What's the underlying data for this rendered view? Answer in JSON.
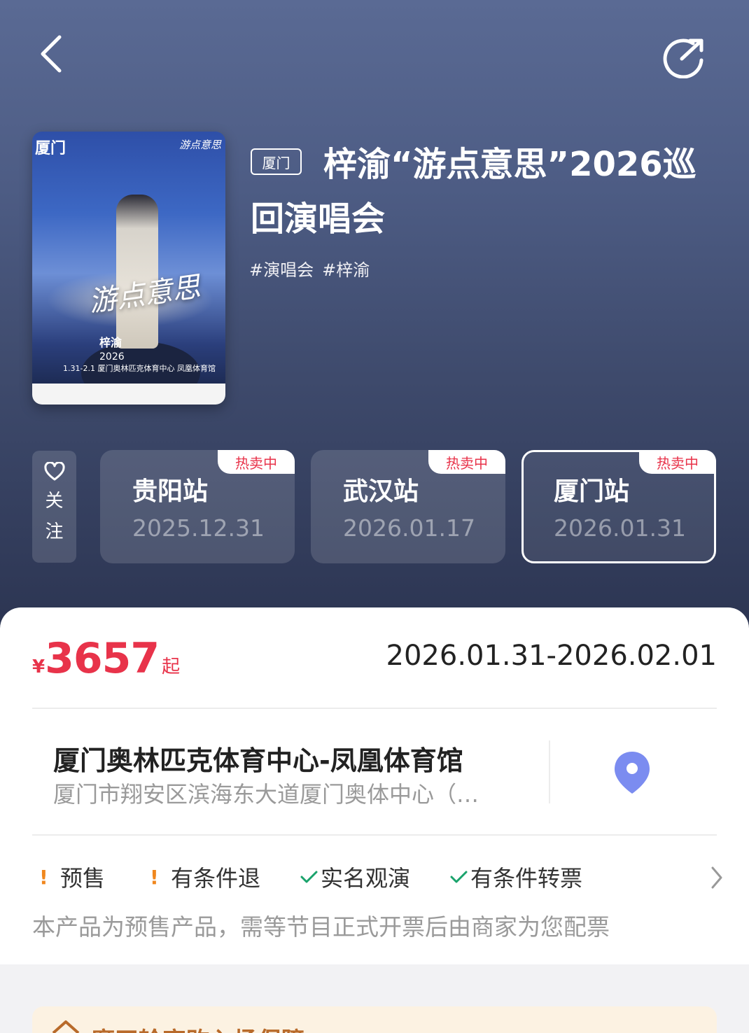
{
  "header": {
    "back_icon": "chevron-left-icon",
    "share_icon": "share-icon"
  },
  "poster": {
    "city": "厦门",
    "logo_text": "游点意思",
    "art_title": "游点意思",
    "artist": "梓渝",
    "year": "2026",
    "date_venue": "1.31-2.1 厦门奥林匹克体育中心 凤凰体育馆"
  },
  "event": {
    "city_tag": "厦门",
    "title": "梓渝“游点意思”2026巡回演唱会",
    "tags": [
      "#演唱会",
      "#梓渝"
    ]
  },
  "follow": {
    "label": "关注",
    "icon": "heart-icon"
  },
  "stations": [
    {
      "name": "贵阳站",
      "date": "2025.12.31",
      "badge": "热卖中",
      "active": false
    },
    {
      "name": "武汉站",
      "date": "2026.01.17",
      "badge": "热卖中",
      "active": false
    },
    {
      "name": "厦门站",
      "date": "2026.01.31",
      "badge": "热卖中",
      "active": true
    }
  ],
  "price": {
    "currency": "¥",
    "amount": "3657",
    "suffix": "起"
  },
  "date_range": "2026.01.31-2026.02.01",
  "venue": {
    "name": "厦门奥林匹克体育中心-凤凰体育馆",
    "address": "厦门市翔安区滨海东大道厦门奥体中心（…",
    "map_icon": "location-pin-icon"
  },
  "policies": [
    {
      "label": "预售",
      "icon": "warning-icon"
    },
    {
      "label": "有条件退",
      "icon": "warning-icon"
    },
    {
      "label": "实名观演",
      "icon": "check-icon"
    },
    {
      "label": "有条件转票",
      "icon": "check-icon"
    }
  ],
  "presale_note": "本产品为预售产品，需等节目正式开票后由商家为您配票",
  "banner": {
    "text": "摩天轮官购入场保障"
  },
  "colors": {
    "accent": "#e8334a",
    "warning": "#f0871d",
    "success": "#1aa36c",
    "map_pin": "#7b8cf0"
  }
}
